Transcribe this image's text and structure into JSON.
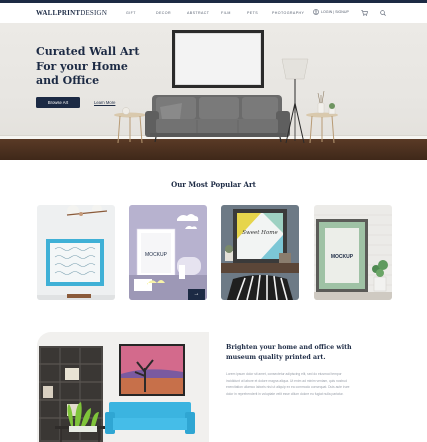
{
  "brand": {
    "logo_bold": "WALLPRINT",
    "logo_thin": "DESIGN"
  },
  "nav": {
    "items": [
      "Gift",
      "Decor",
      "Abstract",
      "Film",
      "Pets",
      "Photography"
    ]
  },
  "header": {
    "login_label": "Login | Signup",
    "icons": [
      "user-icon",
      "cart-icon",
      "search-icon"
    ]
  },
  "hero": {
    "title_line1": "Curated Wall Art",
    "title_line2": "For your Home",
    "title_line3": "and Office",
    "browse_label": "Browse Art",
    "learn_label": "Learn More"
  },
  "popular": {
    "title": "Our Most Popular Art",
    "cards": [
      {
        "name": "floral-poster-card",
        "mockup_text": ""
      },
      {
        "name": "mockup-frame-card",
        "mockup_text": "MOCKUP"
      },
      {
        "name": "sweet-home-card",
        "mockup_text": "Sweet Home"
      },
      {
        "name": "mockup-green-frame-card",
        "mockup_text": "MOCKUP"
      }
    ],
    "arrow_label": "→"
  },
  "feature": {
    "title": "Brighten your home and office with museum quality printed art.",
    "body": "Lorem ipsum dolor sit amet, consectetur adipiscing elit, sed do eiusmod tempor incididunt ut labore et dolore magna aliqua. Ut enim ad minim veniam, quis nostrud exercitation ullamco laboris nisi ut aliquip ex ea commodo consequat. Duis aute irure dolor in reprehenderit in voluptate velit esse cillum dolore eu fugiat nulla pariatur."
  },
  "colors": {
    "navy": "#1c2a44",
    "wall": "#ebe9e5",
    "floor": "#4a2f1f",
    "sofa_blue": "#3bb4e0"
  }
}
